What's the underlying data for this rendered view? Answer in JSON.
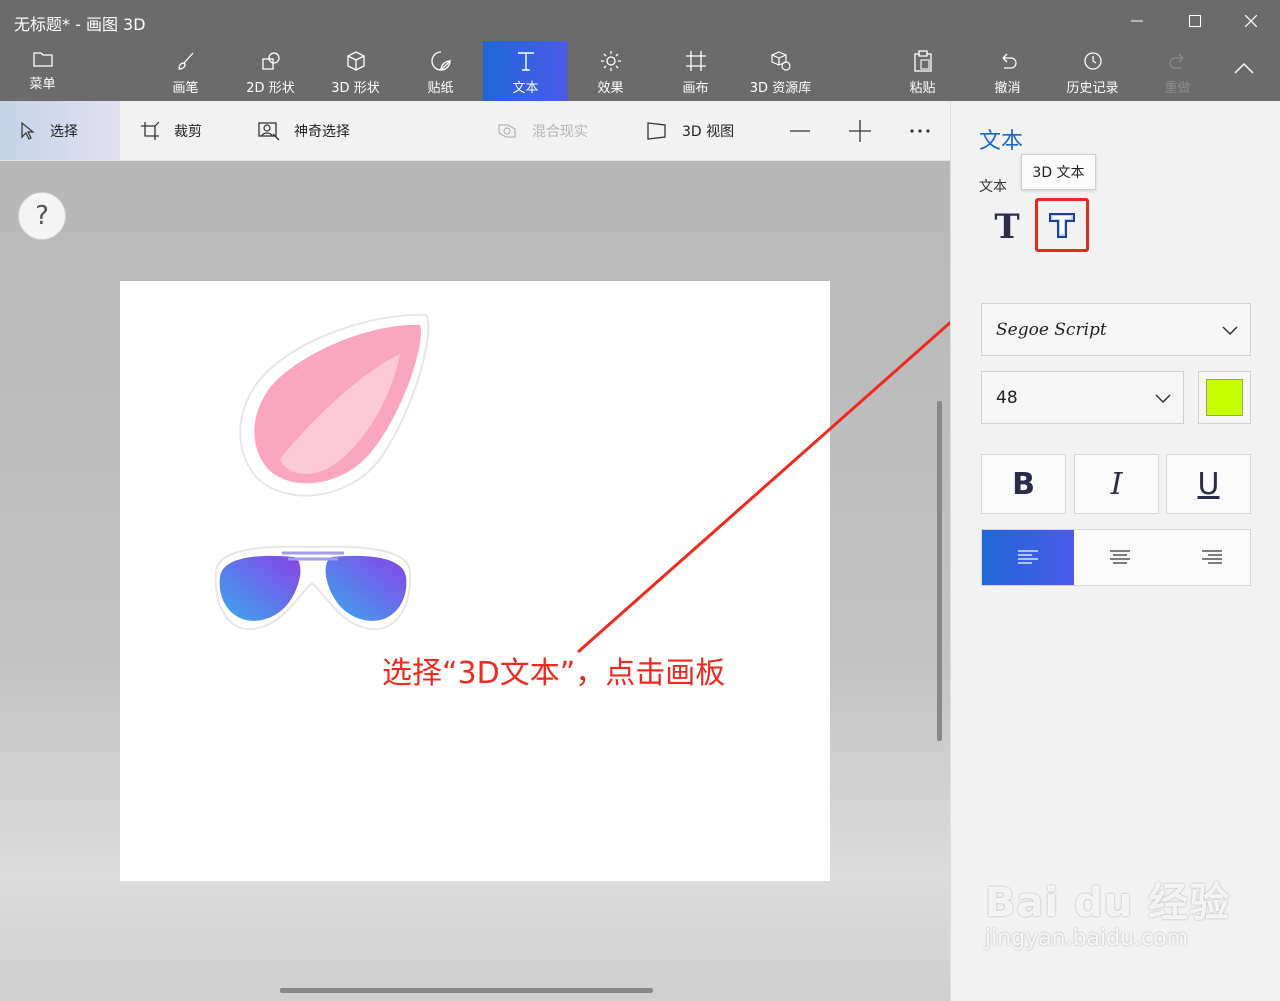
{
  "window": {
    "title": "无标题* - 画图 3D"
  },
  "ribbon": {
    "menu": "菜单",
    "brushes": "画笔",
    "shapes2d": "2D 形状",
    "shapes3d": "3D 形状",
    "stickers": "贴纸",
    "text": "文本",
    "effects": "效果",
    "canvas": "画布",
    "library3d": "3D 资源库",
    "paste": "粘贴",
    "undo": "撤消",
    "history": "历史记录",
    "redo": "重做"
  },
  "toolbar": {
    "select": "选择",
    "crop": "裁剪",
    "magic_select": "神奇选择",
    "mixed_reality": "混合现实",
    "view3d": "3D 视图"
  },
  "workspace": {
    "help": "?",
    "annotation": "选择“3D文本”，点击画板"
  },
  "panel": {
    "title": "文本",
    "subtitle": "文本",
    "tooltip": "3D 文本",
    "text2d_glyph": "T",
    "font": "Segoe Script",
    "size": "48",
    "color": "#c6ff00",
    "bold": "B",
    "italic": "I",
    "underline": "U"
  },
  "watermark": {
    "brand": "Bai du 经验",
    "url": "jingyan.baidu.com"
  }
}
